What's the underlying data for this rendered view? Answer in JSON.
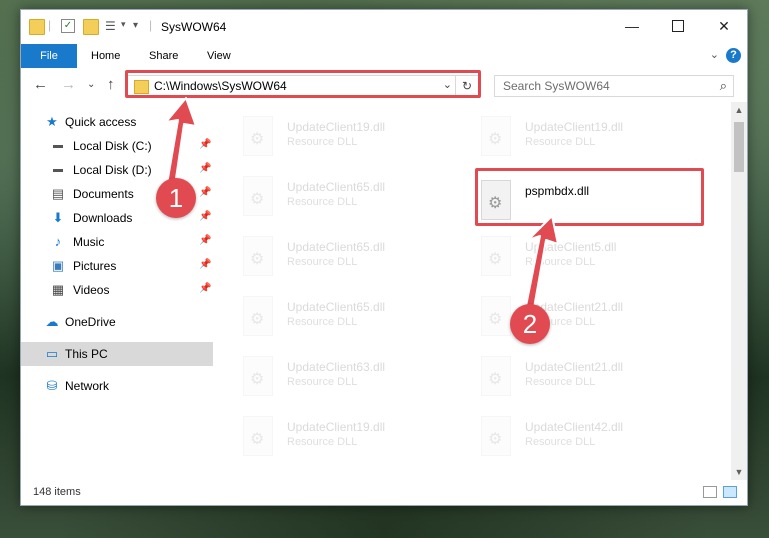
{
  "window": {
    "title": "SysWOW64"
  },
  "ribbon": {
    "tabs": [
      "File",
      "Home",
      "Share",
      "View"
    ],
    "help_label": "?"
  },
  "address_bar": {
    "path": "C:\\Windows\\SysWOW64",
    "search_placeholder": "Search SysWOW64"
  },
  "sidebar": {
    "quick_access": "Quick access",
    "items": [
      {
        "label": "Local Disk (C:)",
        "icon": "hard-drive-icon",
        "pinned": true
      },
      {
        "label": "Local Disk (D:)",
        "icon": "hard-drive-icon",
        "pinned": true
      },
      {
        "label": "Documents",
        "icon": "documents-icon",
        "pinned": true
      },
      {
        "label": "Downloads",
        "icon": "downloads-icon",
        "pinned": true
      },
      {
        "label": "Music",
        "icon": "music-icon",
        "pinned": true
      },
      {
        "label": "Pictures",
        "icon": "pictures-icon",
        "pinned": true
      },
      {
        "label": "Videos",
        "icon": "videos-icon",
        "pinned": true
      }
    ],
    "onedrive": "OneDrive",
    "this_pc": "This PC",
    "network": "Network"
  },
  "files": {
    "left": [
      {
        "name": "UpdateClient19.dll",
        "type": "Resource DLL"
      },
      {
        "name": "UpdateClient65.dll",
        "type": "Resource DLL"
      },
      {
        "name": "UpdateClient65.dll",
        "type": "Resource DLL"
      },
      {
        "name": "UpdateClient65.dll",
        "type": "Resource DLL"
      },
      {
        "name": "UpdateClient63.dll",
        "type": "Resource DLL"
      },
      {
        "name": "UpdateClient19.dll",
        "type": "Resource DLL"
      }
    ],
    "right": [
      {
        "name": "UpdateClient19.dll",
        "type": "Resource DLL"
      },
      {
        "name": "pspmbdx.dll",
        "type": ""
      },
      {
        "name": "UpdateClient5.dll",
        "type": "Resource DLL"
      },
      {
        "name": "UpdateClient21.dll",
        "type": "Resource DLL"
      },
      {
        "name": "UpdateClient21.dll",
        "type": "Resource DLL"
      },
      {
        "name": "UpdateClient42.dll",
        "type": "Resource DLL"
      }
    ]
  },
  "status": {
    "item_count": "148 items"
  },
  "callouts": {
    "step1": "1",
    "step2": "2"
  },
  "colors": {
    "accent": "#1979ca",
    "highlight": "#e04a50",
    "selection": "#d9d9d9"
  }
}
